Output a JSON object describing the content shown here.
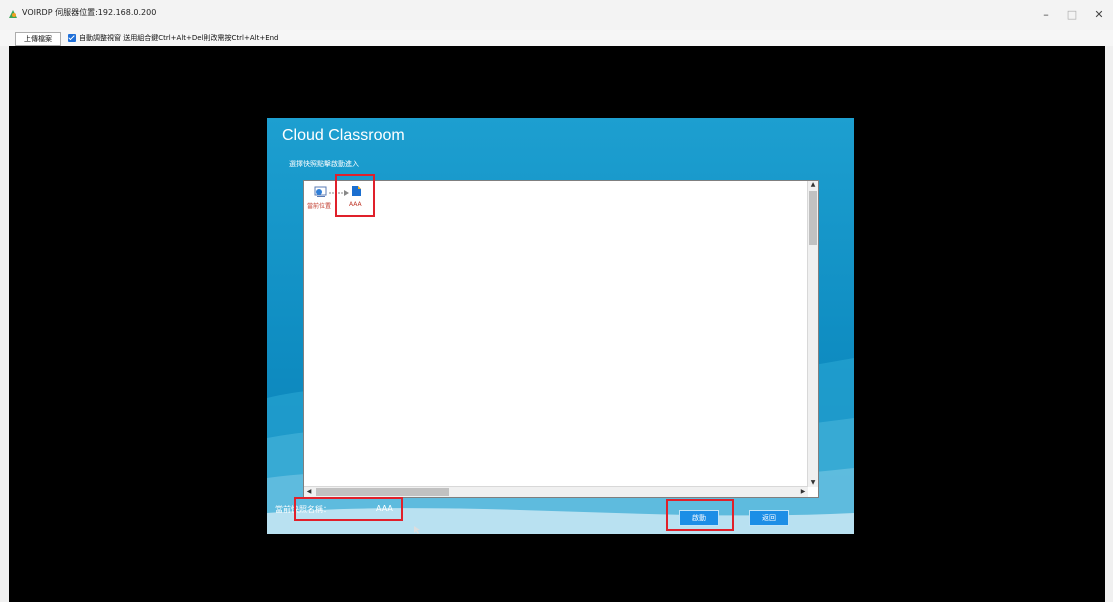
{
  "window": {
    "title": "VOIRDP 伺服器位置:192.168.0.200",
    "controls": {
      "minimize": "–",
      "maximize": "□",
      "close": "✕"
    }
  },
  "toolbar": {
    "upload_label": "上傳檔案",
    "auto_adjust_checked": true,
    "auto_adjust_label": "自動調整視窗 送用組合鍵Ctrl+Alt+Del則改需按Ctrl+Alt+End"
  },
  "dialog": {
    "title": "Cloud Classroom",
    "prompt": "選擇快照點擊啟動進入",
    "snapshots": [
      {
        "name": "當前位置",
        "icon": "current-position-icon"
      },
      {
        "name": "AAA",
        "icon": "snapshot-file-icon"
      }
    ],
    "current_label": "當前快照名稱：",
    "current_value": "AAA",
    "start_label": "啟動",
    "back_label": "返回"
  },
  "colors": {
    "highlight": "#e0202a",
    "dialog_blue": "#1d9fd0",
    "button_blue": "#1c8ee6"
  }
}
